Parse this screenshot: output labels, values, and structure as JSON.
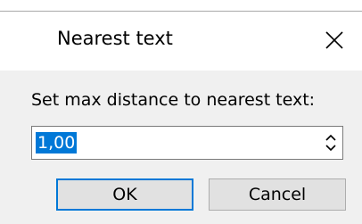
{
  "dialog": {
    "title": "Nearest text",
    "close_icon": "close-icon",
    "prompt": "Set max distance to nearest text:",
    "value": "1,00",
    "spin_icons": [
      "chevron-up-icon",
      "chevron-down-icon"
    ],
    "ok_label": "OK",
    "cancel_label": "Cancel"
  },
  "colors": {
    "accent": "#0078d7",
    "client_background": "#f0f0f0",
    "button_background": "#e1e1e1"
  }
}
